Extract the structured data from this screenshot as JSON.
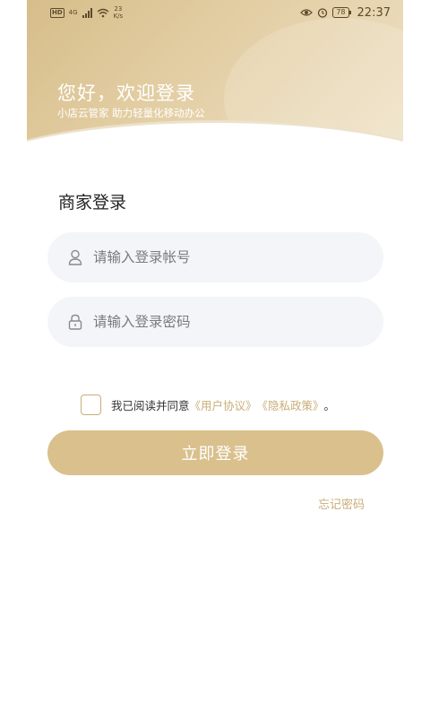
{
  "status_bar": {
    "hd_badge": "HD",
    "network_type": "4G",
    "speed_value": "23",
    "speed_unit": "K/s",
    "battery": "78",
    "time": "22:37",
    "icons": [
      "signal-icon",
      "wifi-icon",
      "eye-icon",
      "alarm-icon",
      "battery-icon"
    ]
  },
  "header": {
    "title": "您好，欢迎登录",
    "subtitle": "小店云管家 助力轻量化移动办公"
  },
  "form": {
    "title": "商家登录",
    "account": {
      "value": "",
      "placeholder": "请输入登录帐号",
      "icon": "user-icon"
    },
    "password": {
      "value": "",
      "placeholder": "请输入登录密码",
      "icon": "lock-icon"
    }
  },
  "agreement": {
    "checked": false,
    "prefix": "我已阅读并同意",
    "user_agreement": "《用户协议》",
    "privacy_policy": "《隐私政策》",
    "suffix": "。"
  },
  "login_button": "立即登录",
  "forgot_password": "忘记密码",
  "colors": {
    "accent": "#d9c08d",
    "link": "#c9ad78",
    "field_bg": "#f4f5f8"
  }
}
